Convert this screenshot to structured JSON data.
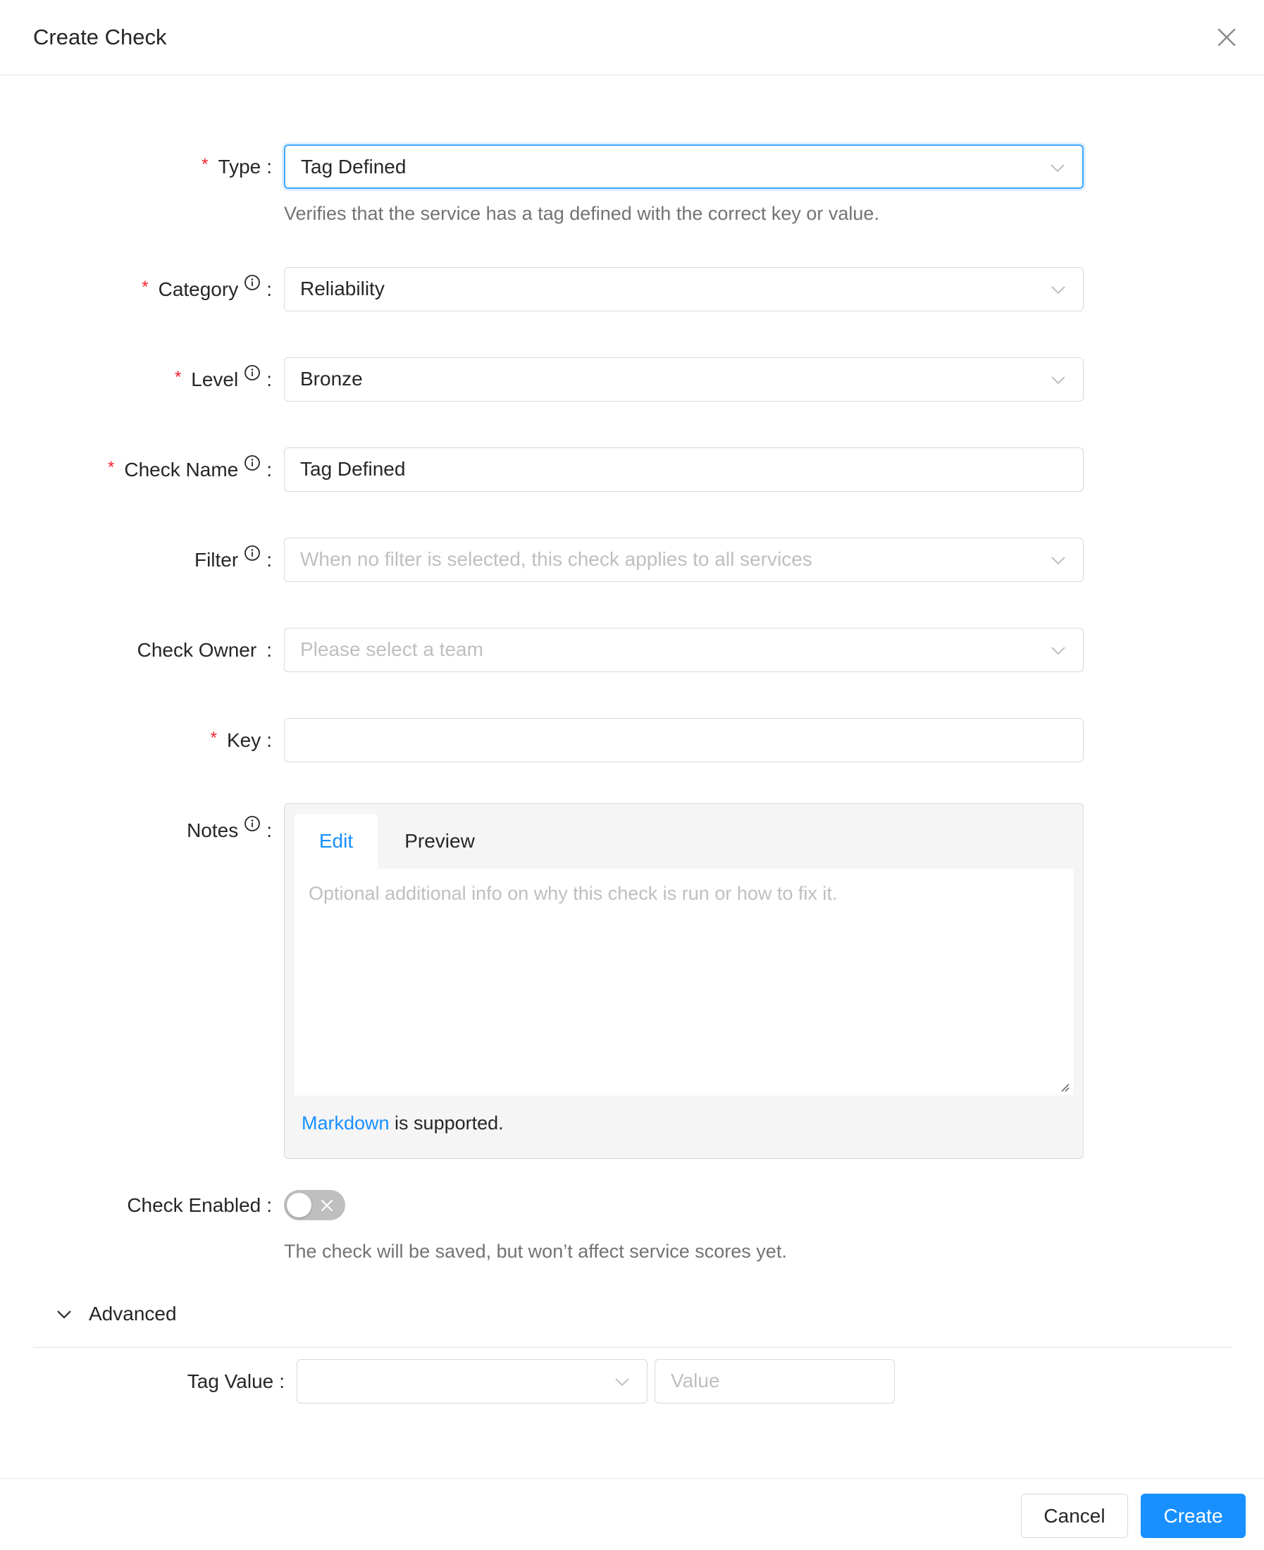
{
  "header": {
    "title": "Create Check"
  },
  "form": {
    "type": {
      "label": "Type",
      "required": true,
      "value": "Tag Defined",
      "help": "Verifies that the service has a tag defined with the correct key or value."
    },
    "category": {
      "label": "Category",
      "required": true,
      "value": "Reliability"
    },
    "level": {
      "label": "Level",
      "required": true,
      "value": "Bronze"
    },
    "check_name": {
      "label": "Check Name",
      "required": true,
      "value": "Tag Defined"
    },
    "filter": {
      "label": "Filter",
      "placeholder": "When no filter is selected, this check applies to all services"
    },
    "check_owner": {
      "label": "Check Owner",
      "placeholder": "Please select a team"
    },
    "key": {
      "label": "Key",
      "required": true,
      "value": ""
    },
    "notes": {
      "label": "Notes",
      "tabs": [
        "Edit",
        "Preview"
      ],
      "active_tab": "Edit",
      "placeholder": "Optional additional info on why this check is run or how to fix it.",
      "markdown_link": "Markdown",
      "markdown_suffix": " is supported."
    },
    "check_enabled": {
      "label": "Check Enabled",
      "enabled": false,
      "help": "The check will be saved, but won’t affect service scores yet."
    }
  },
  "advanced": {
    "label": "Advanced",
    "tag_value": {
      "label": "Tag Value",
      "operator": "",
      "value_placeholder": "Value"
    }
  },
  "footer": {
    "cancel": "Cancel",
    "create": "Create"
  },
  "colors": {
    "accent": "#1890ff",
    "required": "#f5222d",
    "border": "#d9d9d9"
  }
}
